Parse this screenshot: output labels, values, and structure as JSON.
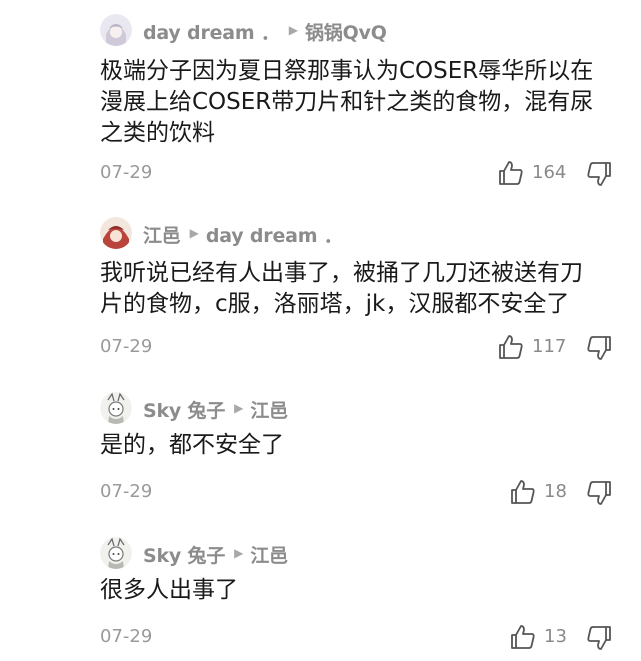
{
  "comments": [
    {
      "user": "day dream ．",
      "reply_to": "锅锅QvQ",
      "text_lines": [
        "极端分子因为夏日祭那事认为COSER辱华所以在",
        "漫展上给COSER带刀片和针之类的食物，混有尿",
        "之类的饮料"
      ],
      "date": "07-29",
      "likes": "164",
      "avatar_icon": "avatar-pale-anime-girl-icon"
    },
    {
      "user": "江邑",
      "reply_to": "day dream ．",
      "text_lines": [
        "我听说已经有人出事了，被捅了几刀还被送有刀",
        "片的食物，c服，洛丽塔，jk，汉服都不安全了"
      ],
      "date": "07-29",
      "likes": "117",
      "avatar_icon": "avatar-red-anime-girl-icon"
    },
    {
      "user": "Sky 兔子",
      "reply_to": "江邑",
      "text_lines": [
        "是的，都不安全了"
      ],
      "date": "07-29",
      "likes": "18",
      "avatar_icon": "avatar-sketch-character-icon"
    },
    {
      "user": "Sky 兔子",
      "reply_to": "江邑",
      "text_lines": [
        "很多人出事了"
      ],
      "date": "07-29",
      "likes": "13",
      "avatar_icon": "avatar-sketch-character-icon"
    }
  ],
  "icons": {
    "like": "thumbs-up-icon",
    "dislike": "thumbs-down-icon",
    "reply_arrow": "reply-arrow-icon"
  },
  "colors": {
    "name": "#8c8c8c",
    "text": "#1a1a1a",
    "meta": "#9a9a9a"
  }
}
